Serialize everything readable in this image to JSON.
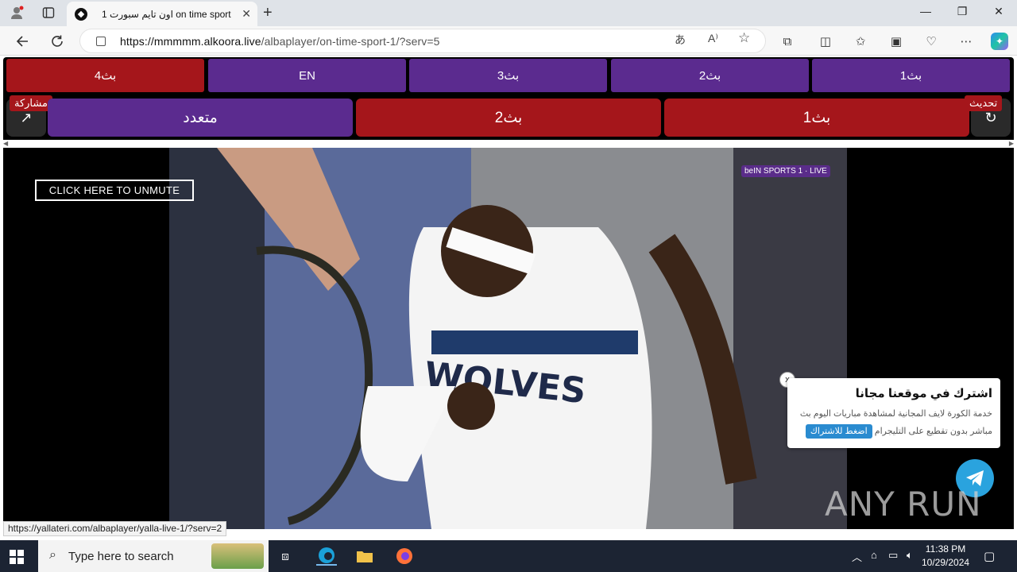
{
  "browser": {
    "tab_title": "اون تايم سبورت 1 on time sport",
    "url_host": "https://mmmmm.alkoora.live",
    "url_path": "/albaplayer/on-time-sport-1/?serv=5",
    "status_url": "https://yallateri.com/albaplayer/yalla-live-1/?serv=2"
  },
  "servers_row1": [
    {
      "label": "بث4",
      "color": "red"
    },
    {
      "label": "EN",
      "color": "purple"
    },
    {
      "label": "بث3",
      "color": "purple"
    },
    {
      "label": "بث2",
      "color": "purple"
    },
    {
      "label": "بث1",
      "color": "purple"
    }
  ],
  "servers_row2": [
    {
      "label": "متعدد",
      "color": "purple"
    },
    {
      "label": "بث2",
      "color": "red"
    },
    {
      "label": "بث1",
      "color": "red"
    }
  ],
  "share_label": "مشاركة",
  "refresh_label": "تحديث",
  "player": {
    "unmute_label": "CLICK HERE TO UNMUTE",
    "channel_logo": "beIN SPORTS 1",
    "live_label": "LIVE"
  },
  "promo": {
    "title": "اشترك في موقعنا مجانا",
    "line1": "خدمة الكورة لايف المجانية لمشاهدة مباريات اليوم بث",
    "line2": "مباشر بدون تقطيع على التليجرام",
    "cta": "اضغط للاشتراك",
    "close": "x"
  },
  "watermark": "ANY RUN",
  "taskbar": {
    "search_placeholder": "Type here to search",
    "time": "11:38 PM",
    "date": "10/29/2024"
  },
  "colors": {
    "purple": "#5b2b8f",
    "red": "#a5161b",
    "telegram": "#2aa3de"
  }
}
